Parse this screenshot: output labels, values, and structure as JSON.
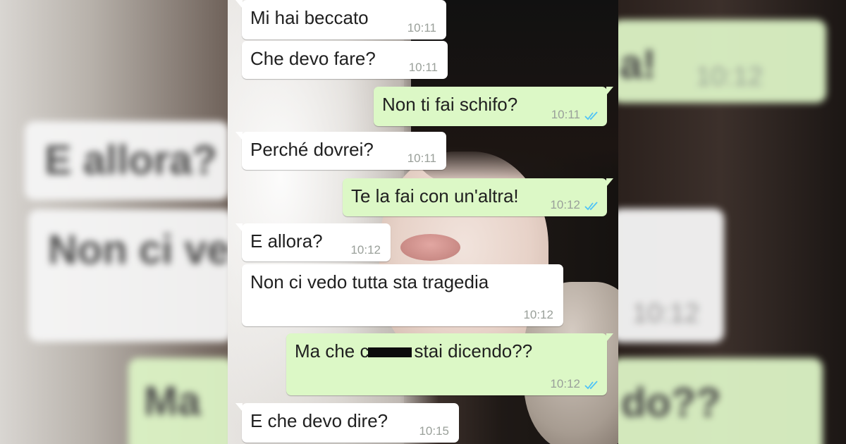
{
  "colors": {
    "incoming_bubble": "#ffffff",
    "outgoing_bubble": "#dcf8c6",
    "timestamp": "#9aa09a",
    "read_ticks": "#4fc3f7",
    "censor_bar": "#0d0d0d"
  },
  "icons": {
    "read_receipt": "double-check-icon"
  },
  "messages": [
    {
      "direction": "in",
      "text": "Mi hai beccato",
      "time": "10:11"
    },
    {
      "direction": "in",
      "text": "Che devo fare?",
      "time": "10:11"
    },
    {
      "direction": "out",
      "text": "Non ti fai schifo?",
      "time": "10:11",
      "read": true
    },
    {
      "direction": "in",
      "text": "Perché dovrei?",
      "time": "10:11"
    },
    {
      "direction": "out",
      "text": "Te la fai con un'altra!",
      "time": "10:12",
      "read": true
    },
    {
      "direction": "in",
      "text": "E allora?",
      "time": "10:12"
    },
    {
      "direction": "in",
      "text": "Non ci vedo tutta sta tragedia",
      "time": "10:12"
    },
    {
      "direction": "out",
      "text_before": "Ma che c",
      "text_after": "stai dicendo??",
      "time": "10:12",
      "read": true,
      "censored": true
    },
    {
      "direction": "in",
      "text": "E che devo dire?",
      "time": "10:15"
    }
  ],
  "blurred_background": {
    "left": [
      "E allora?",
      "Non ci ve",
      "Ma"
    ],
    "right": [
      "a!",
      "10:12",
      "10:12",
      "do??"
    ]
  }
}
